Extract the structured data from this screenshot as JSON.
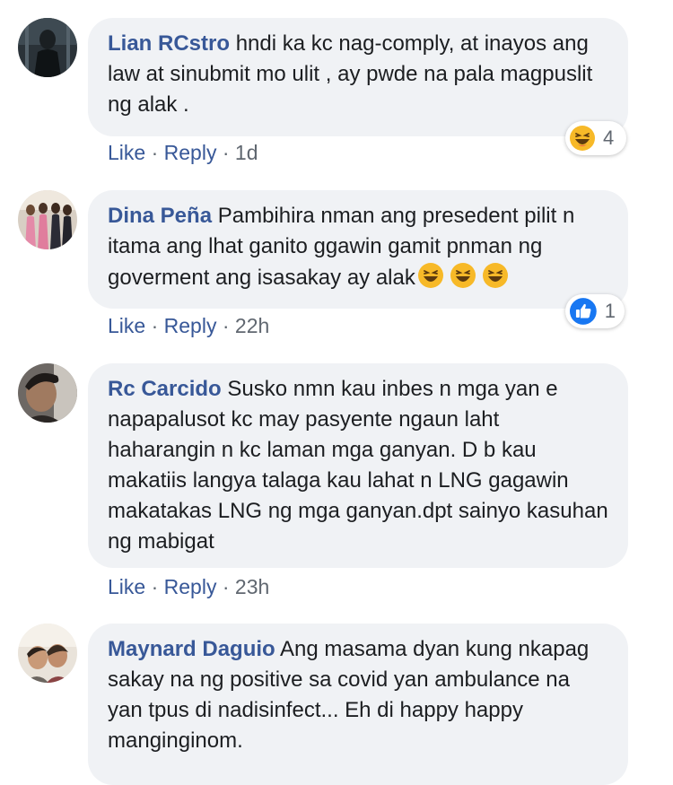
{
  "comments": [
    {
      "author": "Lian RCstro",
      "text": "hndi ka kc nag-comply, at inayos ang law at sinubmit mo ulit , ay pwde na pala magpuslit ng alak .",
      "like": "Like",
      "reply": "Reply",
      "time": "1d",
      "reaction": {
        "icon": "laugh-emoji",
        "count": "4"
      }
    },
    {
      "author": "Dina Peña",
      "text": "Pambihira nman ang presedent pilit n itama ang lhat ganito ggawin gamit pnman ng goverment ang isasakay ay alak",
      "inline_emojis": [
        "laugh-emoji",
        "laugh-emoji",
        "laugh-emoji"
      ],
      "like": "Like",
      "reply": "Reply",
      "time": "22h",
      "reaction": {
        "icon": "like-thumb",
        "count": "1"
      }
    },
    {
      "author": "Rc Carcido",
      "text": "Susko nmn kau inbes n mga yan e napapalusot kc may pasyente ngaun laht haharangin n kc laman mga ganyan. D b kau makatiis langya talaga kau lahat n LNG gagawin makatakas LNG ng mga ganyan.dpt sainyo kasuhan ng mabigat",
      "like": "Like",
      "reply": "Reply",
      "time": "23h"
    },
    {
      "author": "Maynard Daguio",
      "text": "Ang masama dyan kung nkapag sakay na ng positive sa covid yan ambulance na yan tpus di nadisinfect... Eh di happy happy manginginom."
    }
  ],
  "separator": " · ",
  "colors": {
    "link": "#385898",
    "bubble": "#f0f2f5",
    "meta": "#606770",
    "like_blue": "#1877f2",
    "emoji_yellow": "#f7b928"
  }
}
